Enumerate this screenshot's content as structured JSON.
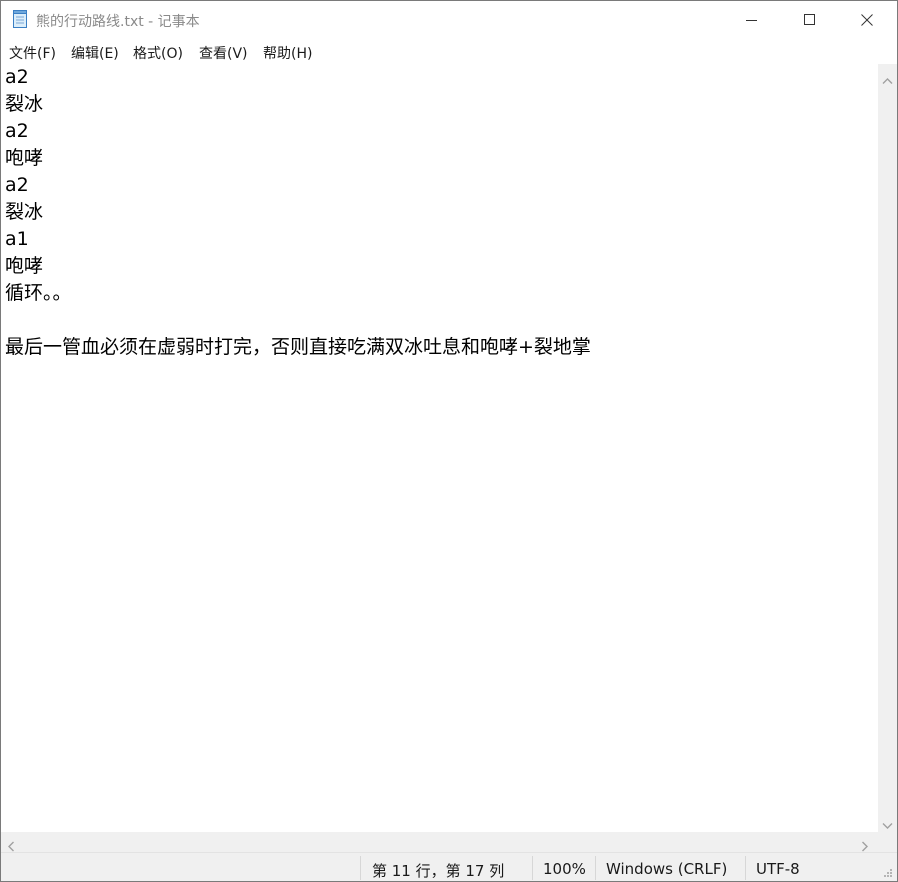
{
  "window": {
    "title": "熊的行动路线.txt - 记事本",
    "app_icon": "notepad-icon",
    "buttons": [
      "minimize-icon",
      "maximize-icon",
      "close-icon"
    ]
  },
  "menu": {
    "items": [
      {
        "label": "文件(F)"
      },
      {
        "label": "编辑(E)"
      },
      {
        "label": "格式(O)"
      },
      {
        "label": "查看(V)"
      },
      {
        "label": "帮助(H)"
      }
    ]
  },
  "editor": {
    "lines": [
      "a2",
      "裂冰",
      "a2",
      "咆哮",
      "a2",
      "裂冰",
      "a1",
      "咆哮",
      "循环。。",
      "",
      "最后一管血必须在虚弱时打完，否则直接吃满双冰吐息和咆哮+裂地掌"
    ]
  },
  "status": {
    "position": "第 11 行，第 17 列",
    "zoom": "100%",
    "line_ending": "Windows (CRLF)",
    "encoding": "UTF-8"
  }
}
